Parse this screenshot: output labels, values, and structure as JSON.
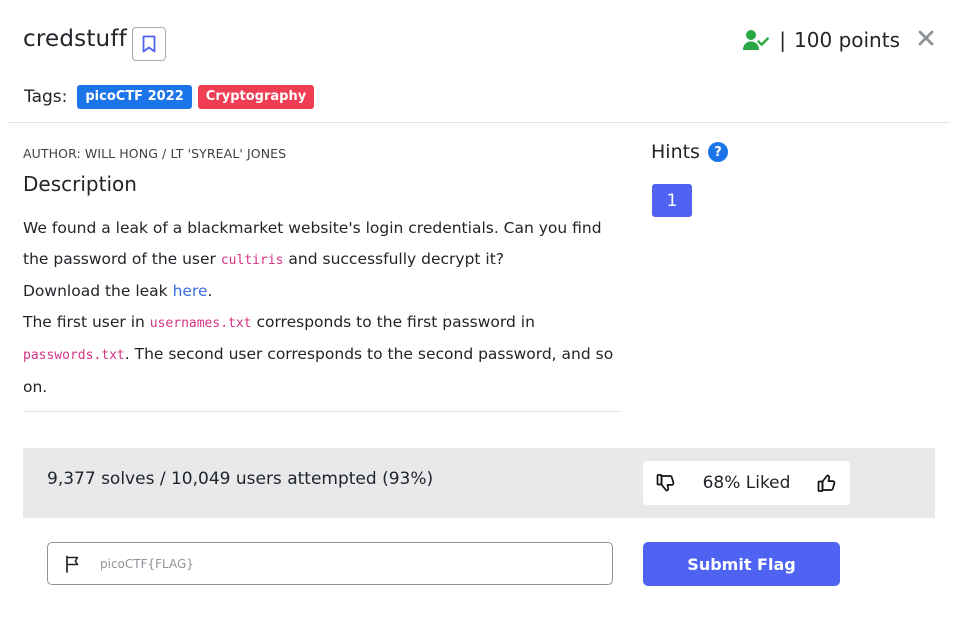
{
  "challenge": {
    "title": "credstuff",
    "points": "100 points",
    "separator": "|"
  },
  "tags": {
    "label": "Tags:",
    "items": [
      {
        "label": "picoCTF 2022",
        "color": "#1c74e9"
      },
      {
        "label": "Cryptography",
        "color": "#ef3d54"
      }
    ]
  },
  "author": "AUTHOR: WILL HONG / LT 'SYREAL' JONES",
  "description": {
    "heading": "Description",
    "p1_before": "We found a leak of a blackmarket website's login credentials. Can you find the password of the user ",
    "p1_code": "cultiris",
    "p1_after": " and successfully decrypt it?",
    "p2_before": "Download the leak ",
    "p2_link": "here",
    "p2_after": ".",
    "p3_before": "The first user in ",
    "p3_code1": "usernames.txt",
    "p3_mid": " corresponds to the first password in ",
    "p3_code2": "passwords.txt",
    "p3_after": ". The second user corresponds to the second password, and so on."
  },
  "hints": {
    "heading": "Hints",
    "help": "?",
    "items": [
      "1"
    ]
  },
  "stats": {
    "solves_text": "9,377 solves / 10,049 users attempted (93%)",
    "liked_text": "68% Liked"
  },
  "flag_form": {
    "placeholder": "picoCTF{FLAG}",
    "submit_label": "Submit Flag"
  },
  "colors": {
    "accent": "#4f63f2",
    "success": "#28a745",
    "code": "#d63384",
    "link": "#3a6fe0"
  },
  "icons": {
    "bookmark": "bookmark-icon",
    "solved": "user-check-icon",
    "close": "close-icon",
    "help": "question-circle-icon",
    "dislike": "thumbs-down-icon",
    "like": "thumbs-up-icon",
    "flag": "flag-icon"
  }
}
